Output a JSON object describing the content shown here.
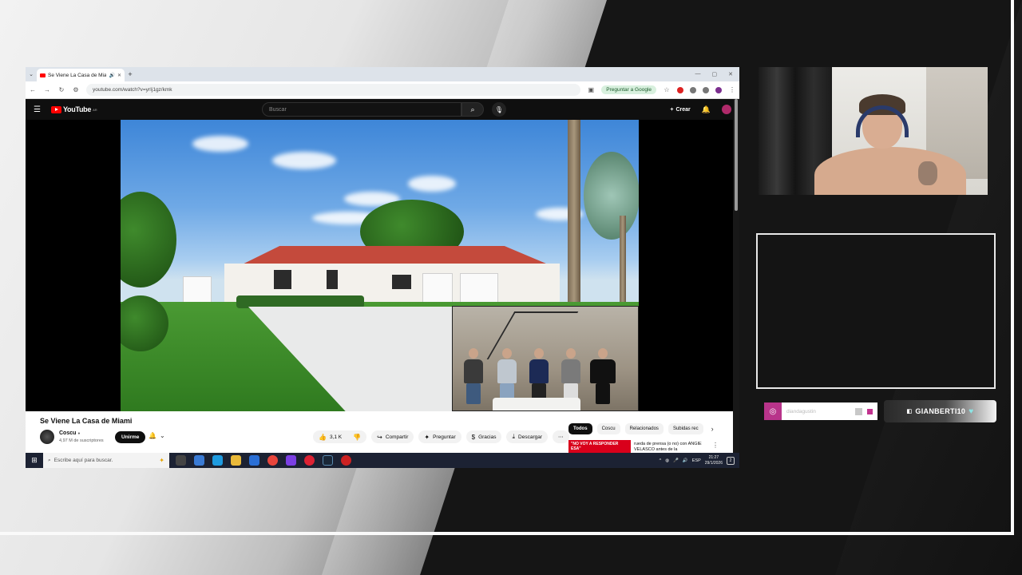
{
  "browser": {
    "tab_title": "Se Viene La Casa de Miami",
    "url": "youtube.com/watch?v=yrIj1gz/kmk",
    "ask_google": "Preguntar a Google"
  },
  "youtube": {
    "logo": "YouTube",
    "country": "AR",
    "search_placeholder": "Buscar",
    "create_label": "Crear",
    "video_title": "Se Viene La Casa de Miami",
    "channel_name": "Coscu",
    "subscribers": "4,97 M de suscriptores",
    "join_label": "Unirme",
    "like_count": "3,1 K",
    "share_label": "Compartir",
    "ask_label": "Preguntar",
    "thanks_label": "Gracias",
    "download_label": "Descargar",
    "chips": [
      "Todos",
      "Coscu",
      "Relacionados",
      "Subidas rec"
    ],
    "rec_thumb_text": "\"NO VOY A RESPONDER ESA\"",
    "rec_title": "rueda de prensa (o no) con ANGIE VELASCO antes de la"
  },
  "taskbar": {
    "search_placeholder": "Escribe aquí para buscar.",
    "lang": "ESP",
    "time": "21:27",
    "date": "29/1/2026",
    "notif_count": "2"
  },
  "overlay": {
    "instagram_handle": "diandagustin",
    "twitch_name": "GIANBERTI10"
  },
  "colors": {
    "youtube_red": "#ff0000",
    "instagram": "#b8348a",
    "join_button": "#0f0f0f"
  }
}
